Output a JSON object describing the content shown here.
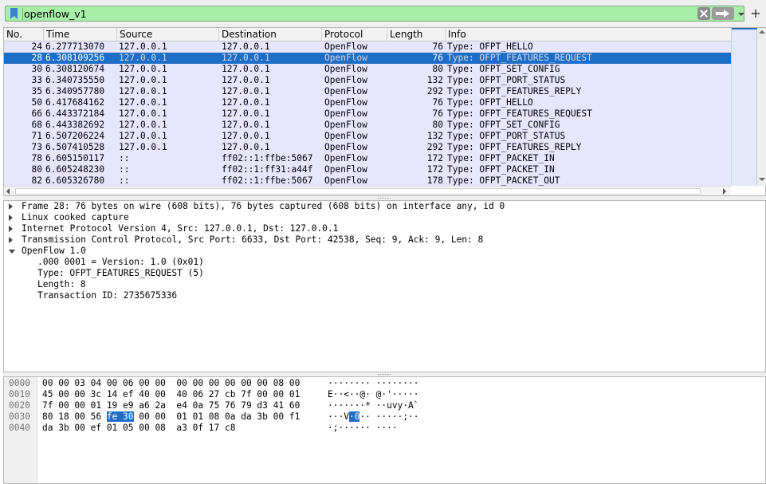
{
  "filter": {
    "value": "openflow_v1",
    "icons": {
      "bookmark": "bookmark-icon",
      "clear": "clear-x-icon",
      "apply": "arrow-right-icon",
      "dropdown": "chevron-down-icon",
      "add": "plus-icon"
    },
    "add_label": "+"
  },
  "packet_list": {
    "columns": [
      "No.",
      "Time",
      "Source",
      "Destination",
      "Protocol",
      "Length",
      "Info"
    ],
    "selected_index": 1,
    "rows": [
      {
        "no": "24",
        "time": "6.277713070",
        "src": "127.0.0.1",
        "dst": "127.0.0.1",
        "proto": "OpenFlow",
        "len": "76",
        "info": "Type: OFPT_HELLO"
      },
      {
        "no": "28",
        "time": "6.308109256",
        "src": "127.0.0.1",
        "dst": "127.0.0.1",
        "proto": "OpenFlow",
        "len": "76",
        "info": "Type: OFPT_FEATURES_REQUEST"
      },
      {
        "no": "30",
        "time": "6.308120674",
        "src": "127.0.0.1",
        "dst": "127.0.0.1",
        "proto": "OpenFlow",
        "len": "80",
        "info": "Type: OFPT_SET_CONFIG"
      },
      {
        "no": "33",
        "time": "6.340735550",
        "src": "127.0.0.1",
        "dst": "127.0.0.1",
        "proto": "OpenFlow",
        "len": "132",
        "info": "Type: OFPT_PORT_STATUS"
      },
      {
        "no": "35",
        "time": "6.340957780",
        "src": "127.0.0.1",
        "dst": "127.0.0.1",
        "proto": "OpenFlow",
        "len": "292",
        "info": "Type: OFPT_FEATURES_REPLY"
      },
      {
        "no": "50",
        "time": "6.417684162",
        "src": "127.0.0.1",
        "dst": "127.0.0.1",
        "proto": "OpenFlow",
        "len": "76",
        "info": "Type: OFPT_HELLO"
      },
      {
        "no": "66",
        "time": "6.443372184",
        "src": "127.0.0.1",
        "dst": "127.0.0.1",
        "proto": "OpenFlow",
        "len": "76",
        "info": "Type: OFPT_FEATURES_REQUEST"
      },
      {
        "no": "68",
        "time": "6.443382692",
        "src": "127.0.0.1",
        "dst": "127.0.0.1",
        "proto": "OpenFlow",
        "len": "80",
        "info": "Type: OFPT_SET_CONFIG"
      },
      {
        "no": "71",
        "time": "6.507206224",
        "src": "127.0.0.1",
        "dst": "127.0.0.1",
        "proto": "OpenFlow",
        "len": "132",
        "info": "Type: OFPT_PORT_STATUS"
      },
      {
        "no": "73",
        "time": "6.507410528",
        "src": "127.0.0.1",
        "dst": "127.0.0.1",
        "proto": "OpenFlow",
        "len": "292",
        "info": "Type: OFPT_FEATURES_REPLY"
      },
      {
        "no": "78",
        "time": "6.605150117",
        "src": "::",
        "dst": "ff02::1:ffbe:5067",
        "proto": "OpenFlow",
        "len": "172",
        "info": "Type: OFPT_PACKET_IN"
      },
      {
        "no": "80",
        "time": "6.605248230",
        "src": "::",
        "dst": "ff02::1:ff31:a44f",
        "proto": "OpenFlow",
        "len": "172",
        "info": "Type: OFPT_PACKET_IN"
      },
      {
        "no": "82",
        "time": "6.605326780",
        "src": "::",
        "dst": "ff02::1:ffbe:5067",
        "proto": "OpenFlow",
        "len": "178",
        "info": "Type: OFPT_PACKET_OUT"
      }
    ]
  },
  "details": {
    "items": [
      {
        "text": "Frame 28: 76 bytes on wire (608 bits), 76 bytes captured (608 bits) on interface any, id 0",
        "expanded": false,
        "child": false
      },
      {
        "text": "Linux cooked capture",
        "expanded": false,
        "child": false
      },
      {
        "text": "Internet Protocol Version 4, Src: 127.0.0.1, Dst: 127.0.0.1",
        "expanded": false,
        "child": false
      },
      {
        "text": "Transmission Control Protocol, Src Port: 6633, Dst Port: 42538, Seq: 9, Ack: 9, Len: 8",
        "expanded": false,
        "child": false
      },
      {
        "text": "OpenFlow 1.0",
        "expanded": true,
        "child": false
      },
      {
        "text": ".000 0001 = Version: 1.0 (0x01)",
        "child": true
      },
      {
        "text": "Type: OFPT_FEATURES_REQUEST (5)",
        "child": true
      },
      {
        "text": "Length: 8",
        "child": true
      },
      {
        "text": "Transaction ID: 2735675336",
        "child": true
      }
    ]
  },
  "bytes": {
    "rows": [
      {
        "offset": "0000",
        "hex": [
          "00 00 03 04 00 06 00 00  00 00 00 00 00 00 08 00"
        ],
        "ascii": [
          "········ ········"
        ]
      },
      {
        "offset": "0010",
        "hex": [
          "45 00 00 3c 14 ef 40 00  40 06 27 cb 7f 00 00 01"
        ],
        "ascii": [
          "E··<··@· @·'·····"
        ]
      },
      {
        "offset": "0020",
        "hex": [
          "7f 00 00 01 19 e9 a6 2a  e4 0a 75 76 79 d3 41 60"
        ],
        "ascii": [
          "·······* ··uvy·A`"
        ]
      },
      {
        "offset": "0030",
        "hex": [
          "80 18 00 56 ",
          "fe 30",
          " 00 00  01 01 08 0a da 3b 00 f1"
        ],
        "ascii": [
          "···V",
          "·0",
          "·· ·····;··"
        ]
      },
      {
        "offset": "0040",
        "hex": [
          "da 3b 00 ef 01 05 00 08  a3 0f 17 c8"
        ],
        "ascii": [
          "·;······ ····"
        ]
      }
    ]
  }
}
